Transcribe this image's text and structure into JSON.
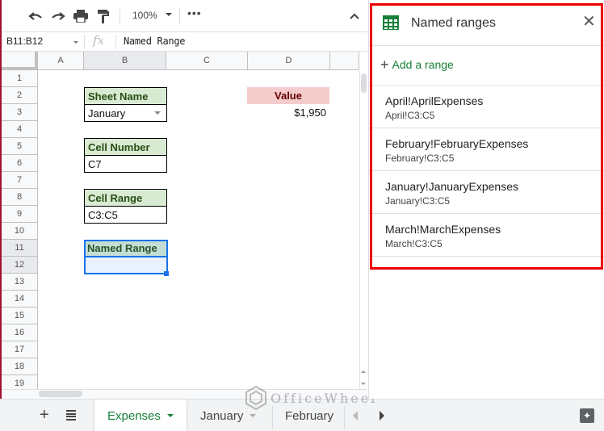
{
  "toolbar": {
    "undo_icon": "undo-icon",
    "redo_icon": "redo-icon",
    "print_icon": "print-icon",
    "paint_format_icon": "paint-format-icon",
    "zoom": "100%",
    "more": "•••",
    "collapse_icon": "chevron-up-icon"
  },
  "formula_bar": {
    "name_box": "B11:B12",
    "fx": "fx",
    "formula": "Named Range"
  },
  "grid": {
    "columns": [
      "A",
      "B",
      "C",
      "D"
    ],
    "rows": [
      "1",
      "2",
      "3",
      "4",
      "5",
      "6",
      "7",
      "8",
      "9",
      "10",
      "11",
      "12",
      "13",
      "14",
      "15",
      "16",
      "17",
      "18",
      "19"
    ],
    "selected_range": "B11:B12",
    "cells": {
      "B2": "Sheet Name",
      "B3": "January",
      "B5": "Cell Number",
      "B6": "C7",
      "B8": "Cell Range",
      "B9": "C3:C5",
      "B11": "Named Range",
      "B12": "",
      "D2": "Value",
      "D3": "$1,950"
    },
    "colors": {
      "header_fill": "#d9ead3",
      "header_text": "#274e13",
      "value_fill": "#f4cccc",
      "value_text": "#660000",
      "selection": "#1a73e8"
    }
  },
  "sheet_tabs": {
    "add_icon": "+",
    "list_icon": "all-sheets-icon",
    "tabs": [
      {
        "label": "Expenses",
        "active": true
      },
      {
        "label": "January",
        "active": false
      },
      {
        "label": "February",
        "active": false
      }
    ],
    "explore_icon": "explore-icon"
  },
  "watermark": "OfficeWheel",
  "named_ranges_panel": {
    "title": "Named ranges",
    "add_label": "Add a range",
    "accent": "#188038",
    "highlight_border": "#ee0000",
    "items": [
      {
        "name": "April!AprilExpenses",
        "range": "April!C3:C5"
      },
      {
        "name": "February!FebruaryExpenses",
        "range": "February!C3:C5"
      },
      {
        "name": "January!JanuaryExpenses",
        "range": "January!C3:C5"
      },
      {
        "name": "March!MarchExpenses",
        "range": "March!C3:C5"
      }
    ]
  }
}
